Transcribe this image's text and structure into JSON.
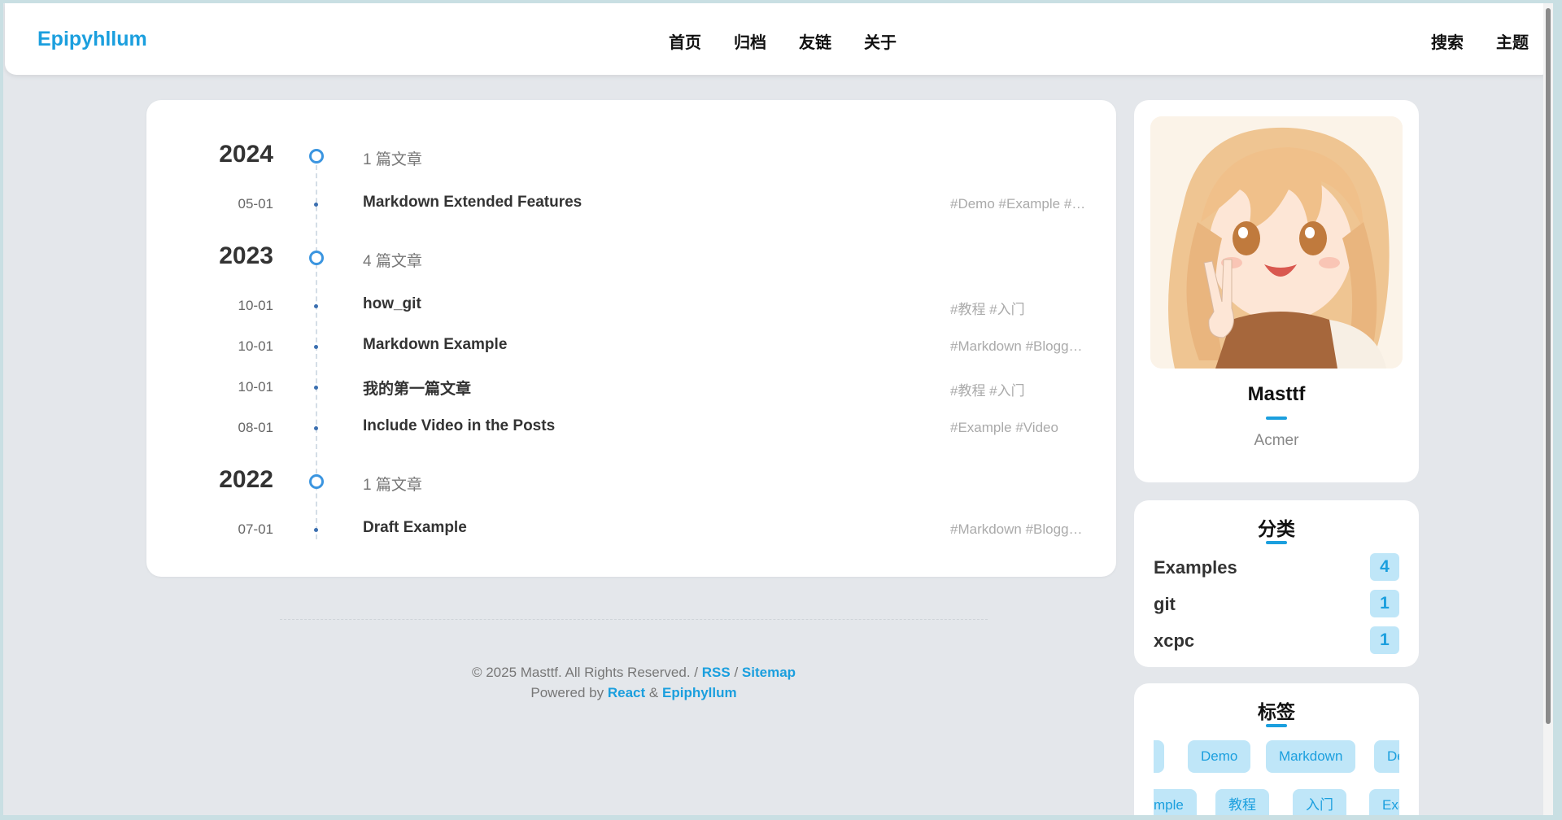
{
  "navbar": {
    "brand": "Epipyhllum",
    "center_links": [
      "首页",
      "归档",
      "友链",
      "关于"
    ],
    "right_links": [
      "搜索",
      "主题"
    ]
  },
  "timeline": [
    {
      "year": "2024",
      "count": "1 篇文章",
      "posts": [
        {
          "date": "05-01",
          "title": "Markdown Extended Features",
          "tags": "#Demo #Example #…"
        }
      ]
    },
    {
      "year": "2023",
      "count": "4 篇文章",
      "posts": [
        {
          "date": "10-01",
          "title": "how_git",
          "tags": "#教程 #入门"
        },
        {
          "date": "10-01",
          "title": "Markdown Example",
          "tags": "#Markdown #Blogg…"
        },
        {
          "date": "10-01",
          "title": "我的第一篇文章",
          "tags": "#教程 #入门"
        },
        {
          "date": "08-01",
          "title": "Include Video in the Posts",
          "tags": "#Example #Video"
        }
      ]
    },
    {
      "year": "2022",
      "count": "1 篇文章",
      "posts": [
        {
          "date": "07-01",
          "title": "Draft Example",
          "tags": "#Markdown #Blogg…"
        }
      ]
    }
  ],
  "footer": {
    "copyright": "© 2025 Masttf. All Rights Reserved. /",
    "rss": "RSS",
    "slash": "/",
    "sitemap": "Sitemap",
    "powered_by": "Powered by",
    "react": "React",
    "amp": "&",
    "epiphyllum": "Epiphyllum"
  },
  "profile": {
    "name": "Masttf",
    "role": "Acmer"
  },
  "categories": {
    "title": "分类",
    "items": [
      {
        "name": "Examples",
        "count": "4"
      },
      {
        "name": "git",
        "count": "1"
      },
      {
        "name": "xcpc",
        "count": "1"
      }
    ]
  },
  "tags": {
    "title": "标签",
    "row1": [
      "n",
      "Demo",
      "Markdown",
      "De"
    ],
    "row2": [
      "xample",
      "教程",
      "入门",
      "Exa"
    ]
  },
  "colors": {
    "accent": "#1b9fde",
    "page_bg": "#e4e7eb",
    "tag_bg": "#bfe6f8"
  }
}
